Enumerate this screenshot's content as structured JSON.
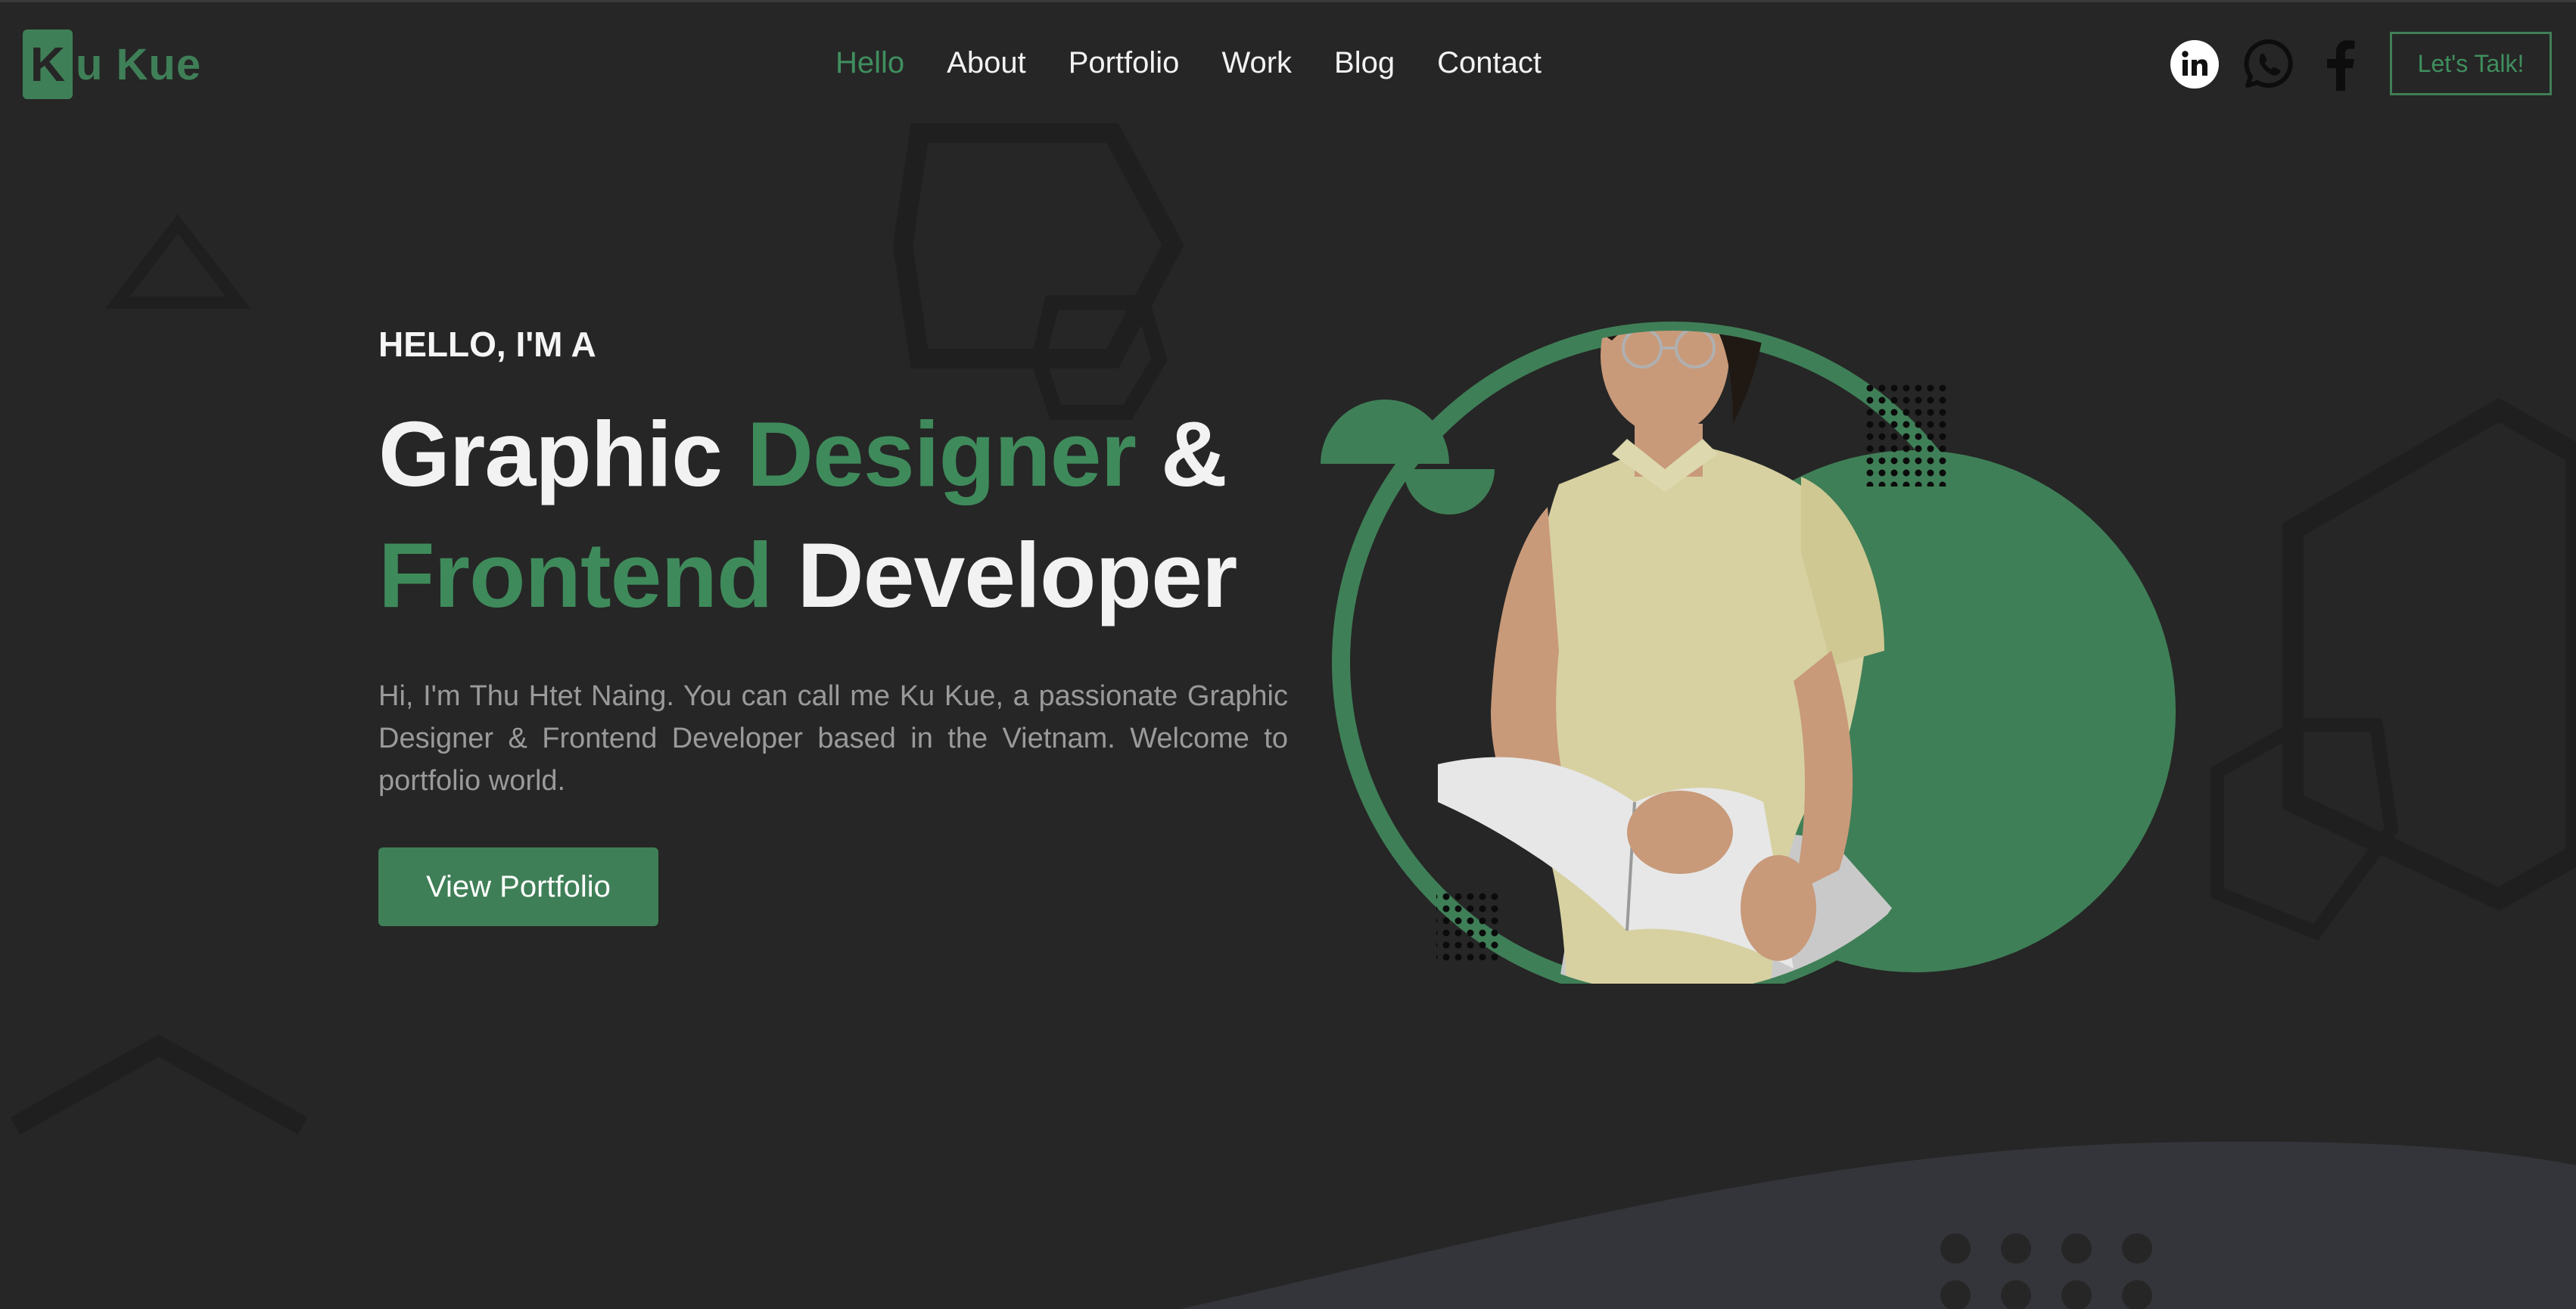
{
  "logo": {
    "badge_letter": "K",
    "rest": "u Kue"
  },
  "nav": {
    "items": [
      {
        "label": "Hello",
        "active": true
      },
      {
        "label": "About",
        "active": false
      },
      {
        "label": "Portfolio",
        "active": false
      },
      {
        "label": "Work",
        "active": false
      },
      {
        "label": "Blog",
        "active": false
      },
      {
        "label": "Contact",
        "active": false
      }
    ]
  },
  "social": {
    "icons": [
      "linkedin-icon",
      "whatsapp-icon",
      "facebook-icon"
    ]
  },
  "header": {
    "cta_label": "Let's Talk!"
  },
  "hero": {
    "eyebrow": "HELLO, I'M A",
    "title_word1": "Graphic",
    "title_word2": "Designer",
    "title_word3": "&",
    "title_word4": "Frontend",
    "title_word5": "Developer",
    "description": "Hi, I'm Thu Htet Naing. You can call me Ku Kue, a passionate Graphic Designer & Frontend Developer based in the Vietnam. Welcome to portfolio world.",
    "button_label": "View Portfolio"
  },
  "colors": {
    "background": "#262626",
    "accent": "#3f7f57",
    "text": "#f2f2f2",
    "muted": "#9a9a9a",
    "wave": "#34353a"
  }
}
